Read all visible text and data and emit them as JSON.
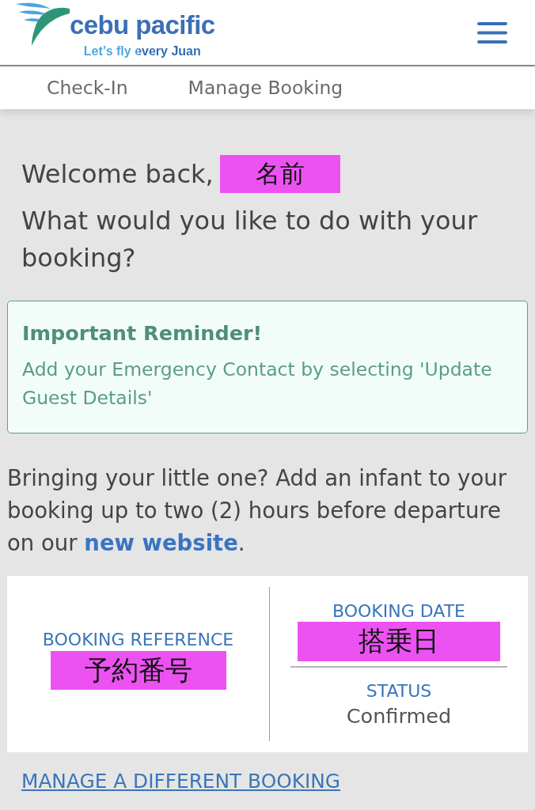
{
  "header": {
    "logo": {
      "wordmark": "cebu pacific",
      "tagline": "Let’s fly every Juan"
    }
  },
  "nav_links": [
    "Check-In",
    "Manage Booking"
  ],
  "greeting": {
    "text": "Welcome back,",
    "name": "名前"
  },
  "question": "What would you like to do with your booking?",
  "reminder": {
    "title": "Important Reminder!",
    "body": "Add your Emergency Contact by selecting 'Update Guest Details'"
  },
  "infant_notice": {
    "before": "Bringing your little one? Add an infant to your booking up to two (2) hours before departure on our ",
    "link": "new website",
    "after": "."
  },
  "booking_summary": {
    "reference": {
      "label": "BOOKING REFERENCE",
      "value": "予約番号"
    },
    "date": {
      "label": "BOOKING DATE",
      "value": "搭乗日"
    },
    "status": {
      "label": "STATUS",
      "value": "Confirmed"
    }
  },
  "footer_link": "MANAGE A DIFFERENT BOOKING"
}
